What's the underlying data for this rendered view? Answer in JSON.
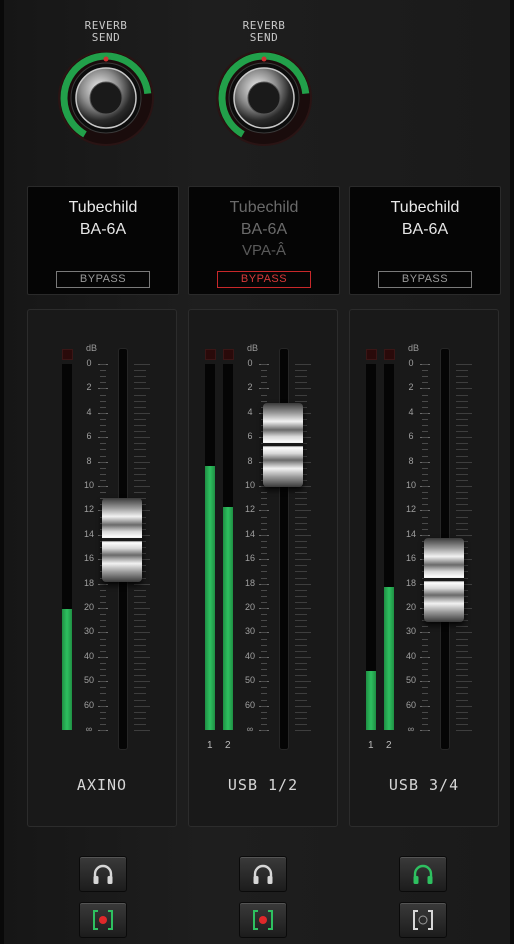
{
  "reverb_sends": [
    {
      "label_line1": "REVERB",
      "label_line2": "SEND",
      "level": 0.78
    },
    {
      "label_line1": "REVERB",
      "label_line2": "SEND",
      "level": 0.78
    }
  ],
  "plugins": [
    {
      "name": "Tubechild",
      "model": "BA-6A",
      "extra": "",
      "bypass_label": "BYPASS",
      "bypassed": false
    },
    {
      "name": "Tubechild",
      "model": "BA-6A",
      "extra": "VPA-Â",
      "bypass_label": "BYPASS",
      "bypassed": true
    },
    {
      "name": "Tubechild",
      "model": "BA-6A",
      "extra": "",
      "bypass_label": "BYPASS",
      "bypassed": false
    }
  ],
  "scale": {
    "unit": "dB",
    "ticks": [
      "0",
      "2",
      "4",
      "6",
      "8",
      "10",
      "12",
      "14",
      "16",
      "18",
      "20",
      "30",
      "40",
      "50",
      "60",
      "∞"
    ]
  },
  "channels": [
    {
      "name": "AXINO",
      "meters": [
        {
          "label": "",
          "level": 0.33
        }
      ],
      "fader_position": 0.52
    },
    {
      "name": "USB 1/2",
      "meters": [
        {
          "label": "1",
          "level": 0.72
        },
        {
          "label": "2",
          "level": 0.61
        }
      ],
      "fader_position": 0.78
    },
    {
      "name": "USB 3/4",
      "meters": [
        {
          "label": "1",
          "level": 0.16
        },
        {
          "label": "2",
          "level": 0.39
        }
      ],
      "fader_position": 0.41
    }
  ],
  "bottom_buttons": [
    {
      "headphones_active": false,
      "record_armed": true
    },
    {
      "headphones_active": false,
      "record_armed": true
    },
    {
      "headphones_active": true,
      "record_armed": false
    }
  ],
  "colors": {
    "meter_green": "#2ec060",
    "knob_ring_green": "#22a04a",
    "bypass_red": "#d83a3a",
    "record_red": "#e0282a"
  }
}
